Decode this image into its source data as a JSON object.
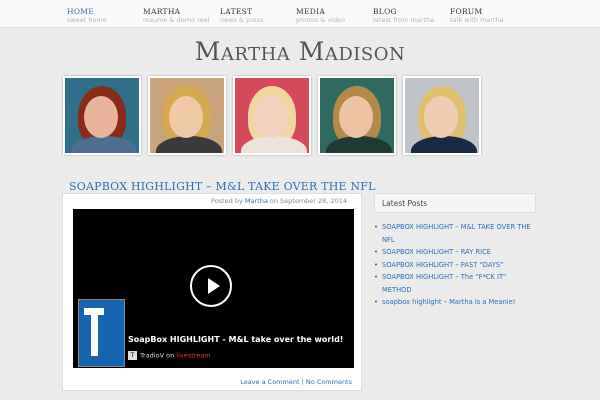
{
  "nav": [
    {
      "title": "HOME",
      "sub": "sweet home"
    },
    {
      "title": "MARTHA",
      "sub": "resume & demo reel"
    },
    {
      "title": "LATEST",
      "sub": "news & press"
    },
    {
      "title": "MEDIA",
      "sub": "photos & video"
    },
    {
      "title": "BLOG",
      "sub": "latest from martha"
    },
    {
      "title": "FORUM",
      "sub": "talk with martha"
    }
  ],
  "site_title": "Martha Madison",
  "photos": [
    {
      "bg": "#2f6f8a",
      "hair": "#8a2a18",
      "skin": "#e8b49a",
      "top": "#4c6e92"
    },
    {
      "bg": "#c9a37a",
      "hair": "#d6a84f",
      "skin": "#f0c9a9",
      "top": "#3a3a3a"
    },
    {
      "bg": "#d44a5a",
      "hair": "#efd7a0",
      "skin": "#f5d2c0",
      "top": "#ece4da"
    },
    {
      "bg": "#2e6a60",
      "hair": "#b58a47",
      "skin": "#ecc3a3",
      "top": "#1f3a33"
    },
    {
      "bg": "#c0c4c8",
      "hair": "#e0c06e",
      "skin": "#f1ccb0",
      "top": "#1b2a44"
    }
  ],
  "post": {
    "title": "SOAPBOX HIGHLIGHT – M&L TAKE OVER THE NFL",
    "meta_prefix": "Posted by",
    "author": "Martha",
    "meta_date": "on September 28, 2014",
    "video_title": "SoapBox HIGHLIGHT - M&L take over the world!",
    "video_brand": "TradioV",
    "video_on": "on",
    "video_live": "livestream",
    "logo_letter": "T",
    "logo_word": "radio",
    "comment_link": "Leave a Comment",
    "separator": "|",
    "comments_count": "No Comments"
  },
  "sidebar": {
    "heading": "Latest Posts",
    "items": [
      "SOAPBOX HIGHLIGHT – M&L TAKE OVER THE NFL",
      "SOAPBOX HIGHLIGHT – RAY RICE",
      "SOAPBOX HIGHLIGHT – PAST “DAYS”",
      "SOAPBOX HIGHLIGHT – The “F*CK IT” METHOD",
      "soapbox highlight – Martha is a Meanie!"
    ]
  },
  "colors": {
    "link": "#2b6fb3",
    "background": "#ebebeb"
  }
}
